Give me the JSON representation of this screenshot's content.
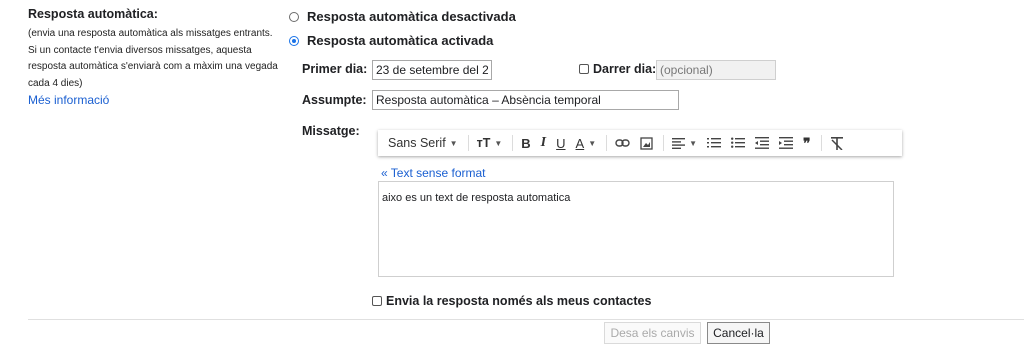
{
  "left": {
    "title": "Resposta automàtica:",
    "desc_lines": [
      "(envia una resposta automàtica als missatges entrants.",
      "Si un contacte t'envia diversos missatges, aquesta",
      "resposta automàtica s'enviarà com a màxim una vegada",
      "cada 4 dies)"
    ],
    "more_info": "Més informació"
  },
  "options": {
    "off_label": "Resposta automàtica desactivada",
    "on_label": "Resposta automàtica activada",
    "selected": "on"
  },
  "fields": {
    "first_day_label": "Primer dia:",
    "first_day_value": "23 de setembre del 2",
    "last_day_label": "Darrer dia:",
    "last_day_placeholder": "(opcional)",
    "subject_label": "Assumpte:",
    "subject_value": "Resposta automàtica – Absència temporal",
    "message_label": "Missatge:"
  },
  "toolbar": {
    "font": "Sans Serif",
    "size_glyph": "тT",
    "bold": "B",
    "italic": "I",
    "underline": "U",
    "text_color": "A",
    "quote": "❞"
  },
  "editor": {
    "plain_text_link": "« Text sense format",
    "body": "aixo es un text de resposta automatica"
  },
  "contacts_only_label": "Envia la resposta només als meus contactes",
  "buttons": {
    "save": "Desa els canvis",
    "cancel": "Cancel·la"
  },
  "colors": {
    "link": "#1a5fd1",
    "accent": "#1a73e8"
  }
}
